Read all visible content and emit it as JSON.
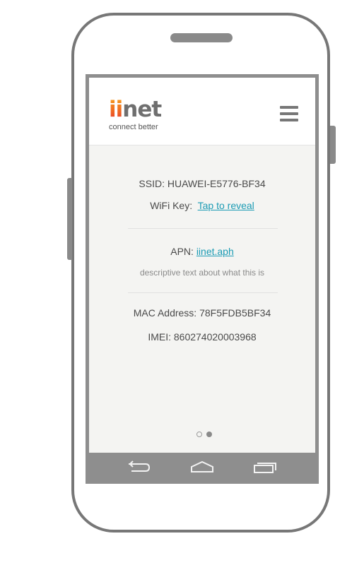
{
  "brand": {
    "logo_prefix": "ii",
    "logo_suffix": "net",
    "tagline": "connect better"
  },
  "header": {
    "menu_icon": "hamburger-menu-icon"
  },
  "wifi": {
    "ssid_label": "SSID:",
    "ssid_value": "HUAWEI-E5776-BF34",
    "key_label": "WiFi Key:",
    "key_link": "Tap to reveal"
  },
  "apn": {
    "label": "APN:",
    "value": "iinet.aph",
    "description": "descriptive text about what this is"
  },
  "device": {
    "mac_label": "MAC Address:",
    "mac_value": "78F5FDB5BF34",
    "imei_label": "IMEI:",
    "imei_value": "860274020003968"
  },
  "pager": {
    "page_count": 2,
    "active_page": 2
  },
  "navbar": {
    "back_icon": "back-icon",
    "home_icon": "home-icon",
    "recents_icon": "recent-apps-icon"
  },
  "colors": {
    "link": "#1b9bb4",
    "text": "#4a4a4a",
    "logo_gray": "#6f6f6f",
    "logo_orange": "#f06a22",
    "frame": "#777777"
  }
}
